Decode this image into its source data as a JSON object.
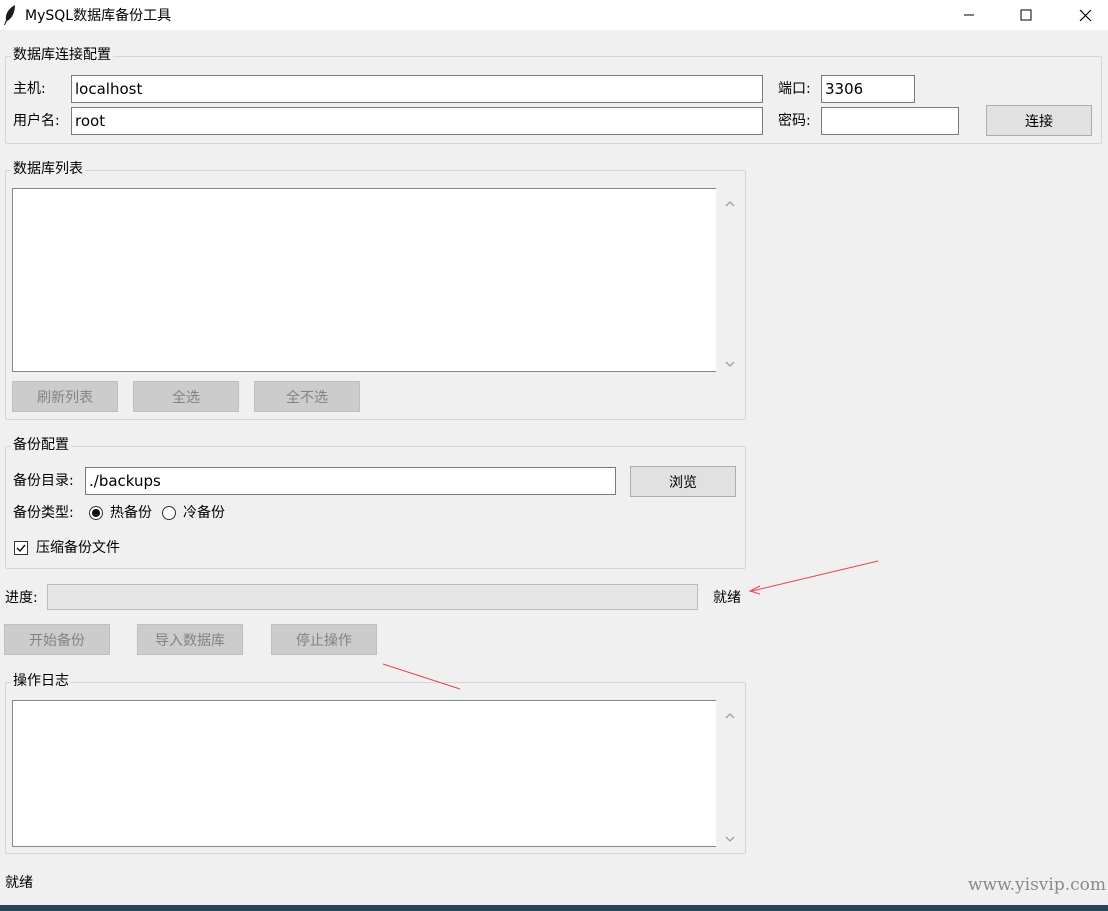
{
  "window": {
    "title": "MySQL数据库备份工具",
    "controls": [
      "minimize-icon",
      "maximize-icon",
      "close-icon"
    ]
  },
  "connection": {
    "legend": "数据库连接配置",
    "host_label": "主机:",
    "host_value": "localhost",
    "port_label": "端口:",
    "port_value": "3306",
    "user_label": "用户名:",
    "user_value": "root",
    "password_label": "密码:",
    "password_value": "",
    "connect_button": "连接"
  },
  "db_list": {
    "legend": "数据库列表",
    "items": [],
    "refresh_button": "刷新列表",
    "select_all_button": "全选",
    "select_none_button": "全不选"
  },
  "backup_config": {
    "legend": "备份配置",
    "dir_label": "备份目录:",
    "dir_value": "./backups",
    "browse_button": "浏览",
    "type_label": "备份类型:",
    "type_options": [
      {
        "label": "热备份",
        "selected": true
      },
      {
        "label": "冷备份",
        "selected": false
      }
    ],
    "compress_label": "压缩备份文件",
    "compress_checked": true
  },
  "progress": {
    "label": "进度:",
    "value_percent": 0,
    "status": "就绪"
  },
  "actions": {
    "start_button": "开始备份",
    "import_button": "导入数据库",
    "stop_button": "停止操作"
  },
  "log": {
    "legend": "操作日志",
    "content": ""
  },
  "statusbar": {
    "text": "就绪"
  },
  "watermark": "www.yisvip.com",
  "colors": {
    "annotation_arrow": "#e8434f",
    "taskbar": "#27465a"
  }
}
